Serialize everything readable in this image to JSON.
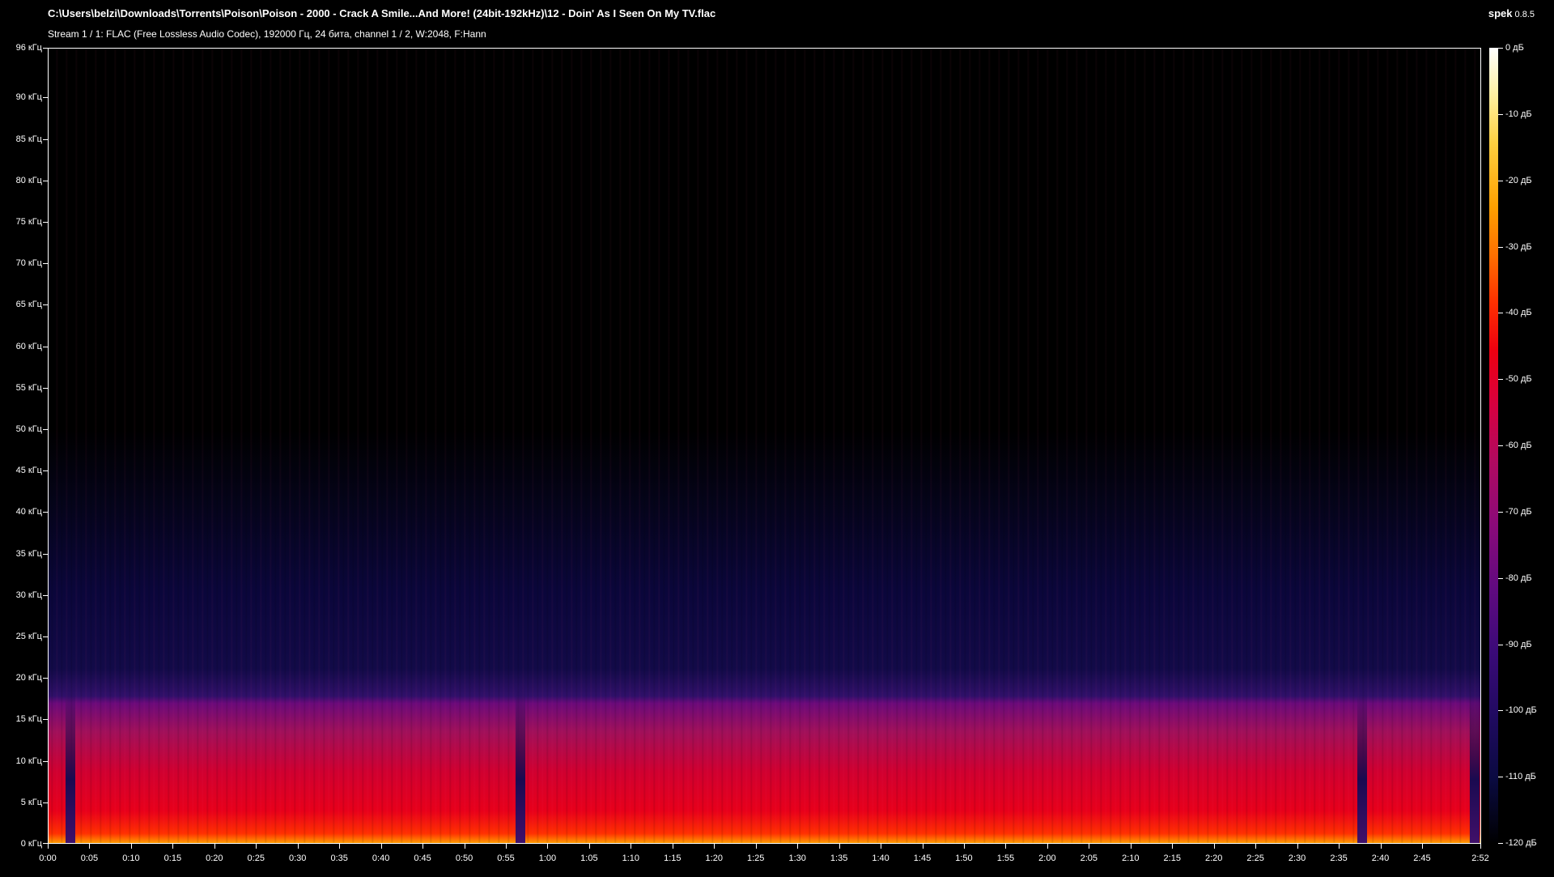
{
  "header": {
    "file_path": "C:\\Users\\belzi\\Downloads\\Torrents\\Poison\\Poison - 2000 - Crack A Smile...And More! (24bit-192kHz)\\12 - Doin' As I Seen On My TV.flac",
    "stream_info": "Stream 1 / 1: FLAC (Free Lossless Audio Codec), 192000 Гц, 24 бита, channel 1 / 2, W:2048, F:Hann",
    "app_name": "spek",
    "app_version": "0.8.5"
  },
  "frequency_axis": {
    "labels": [
      "96 кГц",
      "90 кГц",
      "85 кГц",
      "80 кГц",
      "75 кГц",
      "70 кГц",
      "65 кГц",
      "60 кГц",
      "55 кГц",
      "50 кГц",
      "45 кГц",
      "40 кГц",
      "35 кГц",
      "30 кГц",
      "25 кГц",
      "20 кГц",
      "15 кГц",
      "10 кГц",
      "5 кГц",
      "0 кГц"
    ],
    "values_khz": [
      96,
      90,
      85,
      80,
      75,
      70,
      65,
      60,
      55,
      50,
      45,
      40,
      35,
      30,
      25,
      20,
      15,
      10,
      5,
      0
    ],
    "max_khz": 96
  },
  "time_axis": {
    "labels": [
      "0:00",
      "0:05",
      "0:10",
      "0:15",
      "0:20",
      "0:25",
      "0:30",
      "0:35",
      "0:40",
      "0:45",
      "0:50",
      "0:55",
      "1:00",
      "1:05",
      "1:10",
      "1:15",
      "1:20",
      "1:25",
      "1:30",
      "1:35",
      "1:40",
      "1:45",
      "1:50",
      "1:55",
      "2:00",
      "2:05",
      "2:10",
      "2:15",
      "2:20",
      "2:25",
      "2:30",
      "2:35",
      "2:40",
      "2:45",
      "2:52"
    ],
    "seconds": [
      0,
      5,
      10,
      15,
      20,
      25,
      30,
      35,
      40,
      45,
      50,
      55,
      60,
      65,
      70,
      75,
      80,
      85,
      90,
      95,
      100,
      105,
      110,
      115,
      120,
      125,
      130,
      135,
      140,
      145,
      150,
      155,
      160,
      165,
      172
    ],
    "duration_s": 172
  },
  "level_scale": {
    "labels": [
      "0 дБ",
      "-10 дБ",
      "-20 дБ",
      "-30 дБ",
      "-40 дБ",
      "-50 дБ",
      "-60 дБ",
      "-70 дБ",
      "-80 дБ",
      "-90 дБ",
      "-100 дБ",
      "-110 дБ",
      "-120 дБ"
    ],
    "values_db": [
      0,
      -10,
      -20,
      -30,
      -40,
      -50,
      -60,
      -70,
      -80,
      -90,
      -100,
      -110,
      -120
    ],
    "min_db": -120
  },
  "spectrogram": {
    "colormap": [
      "#000000",
      "#1a0a50",
      "#6a0a7a",
      "#d00030",
      "#ff3000",
      "#ffa000",
      "#ffffff"
    ],
    "dips_s": [
      2.5,
      56.5,
      157.5,
      171
    ]
  }
}
